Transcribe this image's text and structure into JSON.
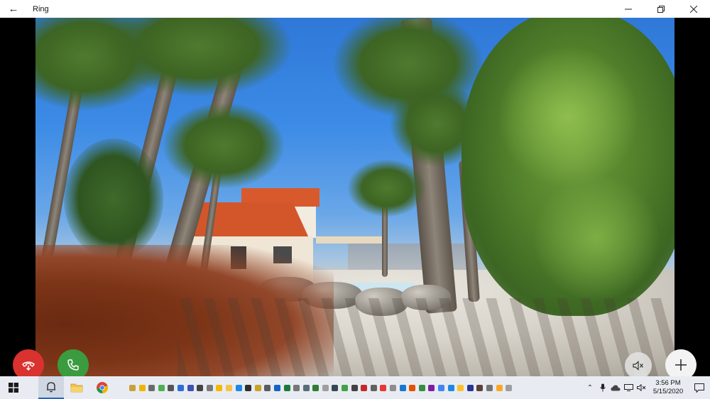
{
  "window": {
    "title": "Ring",
    "controls": [
      "minimize",
      "maximize",
      "close"
    ]
  },
  "camera_view": {
    "scene": "live-video"
  },
  "call_controls": {
    "decline_icon": "hangup-phone-icon",
    "answer_icon": "phone-icon",
    "mute_icon": "speaker-muted-icon",
    "add_icon": "plus-icon",
    "decline_color": "#d9322f",
    "answer_color": "#3b9b3f"
  },
  "taskbar": {
    "pinned": [
      "start-icon",
      "ring-bell-icon",
      "file-explorer-icon",
      "chrome-icon"
    ],
    "clock": {
      "time": "3:56 PM",
      "date": "5/15/2020"
    },
    "accent": "#2b63b8"
  }
}
